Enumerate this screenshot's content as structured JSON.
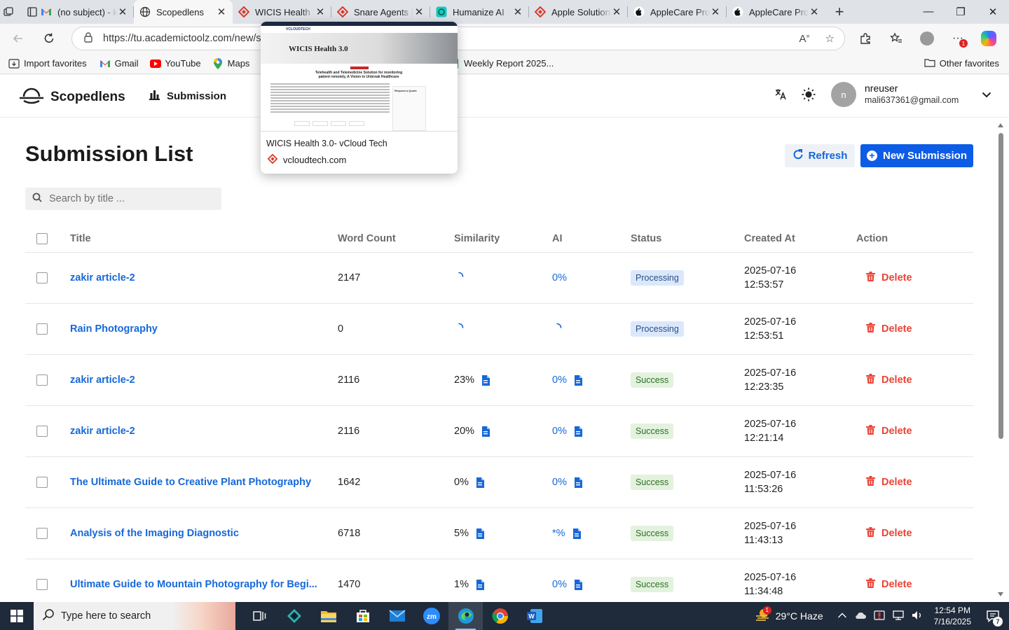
{
  "browser": {
    "tabs": [
      {
        "title": "(no subject) - k",
        "favicon": "gmail-icon",
        "active": false
      },
      {
        "title": "Scopedlens",
        "favicon": "globe-icon",
        "active": true
      },
      {
        "title": "WICIS Health 3.",
        "favicon": "vcloud-icon",
        "active": false
      },
      {
        "title": "Snare Agents |",
        "favicon": "vcloud-icon",
        "active": false
      },
      {
        "title": "Humanize AI",
        "favicon": "humanize-icon",
        "active": false
      },
      {
        "title": "Apple Solution",
        "favicon": "vcloud-icon",
        "active": false
      },
      {
        "title": "AppleCare Prof",
        "favicon": "apple-icon",
        "active": false
      },
      {
        "title": "AppleCare Prof",
        "favicon": "apple-icon",
        "active": false
      }
    ],
    "address": "https://tu.academictoolz.com/new/s",
    "favorites": [
      {
        "label": "Import favorites",
        "icon": "import-icon"
      },
      {
        "label": "Gmail",
        "icon": "gmail-icon"
      },
      {
        "label": "YouTube",
        "icon": "youtube-icon"
      },
      {
        "label": "Maps",
        "icon": "maps-pin-icon"
      },
      {
        "label": "Weekly Report 2025...",
        "icon": "sheets-icon"
      }
    ],
    "other_favorites": "Other favorites",
    "extension_badge": "1",
    "preview": {
      "page_title": "WICIS Health 3.0- vCloud Tech",
      "domain": "vcloudtech.com",
      "thumb_heading": "WICIS Health 3.0",
      "thumb_brand": "VCLOUDTECH",
      "thumb_subheading": "Telehealth and Telemedicine Solution for monitoring patient remotely, A Vision to Unbreak Healthcare",
      "thumb_quote": "Request a Quote"
    }
  },
  "app": {
    "brand": "Scopedlens",
    "nav_submission": "Submission",
    "user_initial": "n",
    "user_name": "nreuser",
    "user_email": "mali637361@gmail.com"
  },
  "main": {
    "title": "Submission List",
    "refresh_label": "Refresh",
    "new_submission_label": "New Submission",
    "search_placeholder": "Search by title ...",
    "columns": {
      "title": "Title",
      "word_count": "Word Count",
      "similarity": "Similarity",
      "ai": "AI",
      "status": "Status",
      "created_at": "Created At",
      "action": "Action"
    },
    "delete_label": "Delete",
    "rows": [
      {
        "title": "zakir article-2",
        "word_count": "2147",
        "similarity": "",
        "ai": "0%",
        "status": "Processing",
        "date": "2025-07-16",
        "time": "12:53:57"
      },
      {
        "title": "Rain Photography",
        "word_count": "0",
        "similarity": "",
        "ai": "",
        "status": "Processing",
        "date": "2025-07-16",
        "time": "12:53:51"
      },
      {
        "title": "zakir article-2",
        "word_count": "2116",
        "similarity": "23%",
        "ai": "0%",
        "status": "Success",
        "date": "2025-07-16",
        "time": "12:23:35"
      },
      {
        "title": "zakir article-2",
        "word_count": "2116",
        "similarity": "20%",
        "ai": "0%",
        "status": "Success",
        "date": "2025-07-16",
        "time": "12:21:14"
      },
      {
        "title": "The Ultimate Guide to Creative Plant Photography",
        "word_count": "1642",
        "similarity": "0%",
        "ai": "0%",
        "status": "Success",
        "date": "2025-07-16",
        "time": "11:53:26"
      },
      {
        "title": "Analysis of the Imaging Diagnostic",
        "word_count": "6718",
        "similarity": "5%",
        "ai": "*%",
        "status": "Success",
        "date": "2025-07-16",
        "time": "11:43:13"
      },
      {
        "title": "Ultimate Guide to Mountain Photography for Begi...",
        "word_count": "1470",
        "similarity": "1%",
        "ai": "0%",
        "status": "Success",
        "date": "2025-07-16",
        "time": "11:34:48"
      }
    ]
  },
  "taskbar": {
    "search_placeholder": "Type here to search",
    "weather": "29°C  Haze",
    "time": "12:54 PM",
    "date": "7/16/2025",
    "weather_badge": "1",
    "notification_count": "7"
  }
}
